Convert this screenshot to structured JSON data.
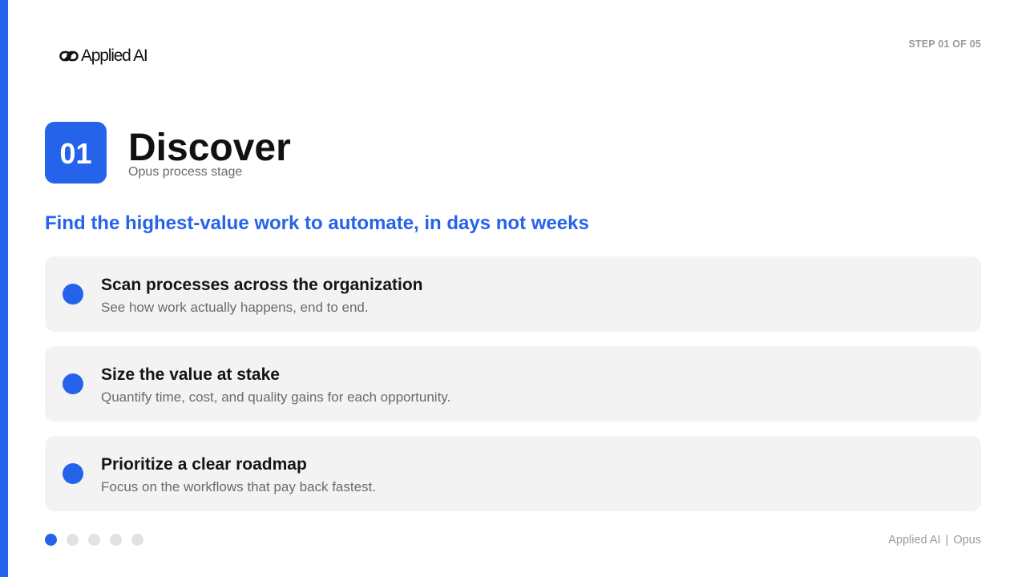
{
  "brand": {
    "name": "Applied AI",
    "accent_color": "#2563EB",
    "logo_icon": "linked-rings-logo"
  },
  "header": {
    "step_indicator": "STEP 01 OF 05"
  },
  "stage": {
    "number": "01",
    "title": "Discover",
    "subtitle": "Opus process stage"
  },
  "headline": "Find the highest-value work to automate, in days not weeks",
  "items": [
    {
      "title": "Scan processes across the organization",
      "description": "See how work actually happens, end to end."
    },
    {
      "title": "Size the value at stake",
      "description": "Quantify time, cost, and quality gains for each opportunity."
    },
    {
      "title": "Prioritize a clear roadmap",
      "description": "Focus on the workflows that pay back fastest."
    }
  ],
  "pagination": {
    "current": 1,
    "total": 5
  },
  "footer": {
    "left": "Applied AI",
    "separator": "|",
    "right": "Opus"
  }
}
